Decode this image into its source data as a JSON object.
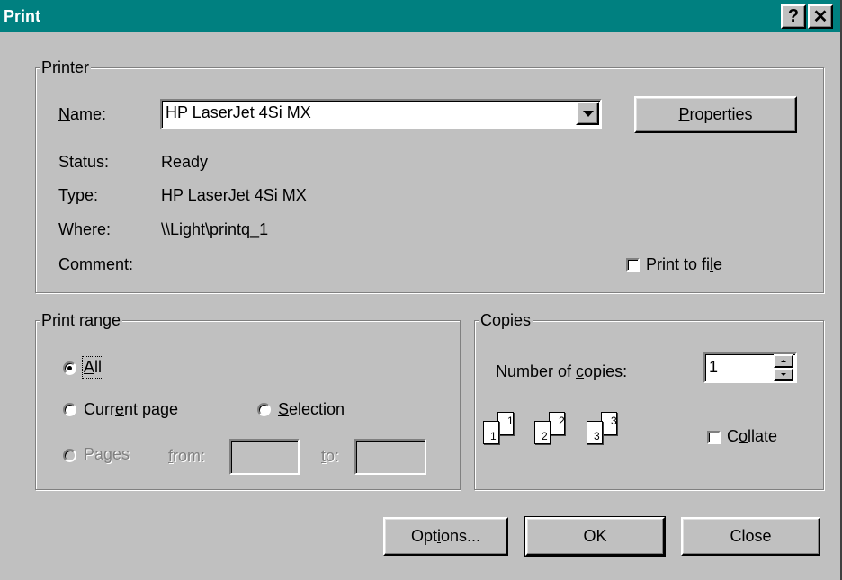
{
  "title": "Print",
  "titlebar": {
    "help": "?",
    "close": "✕"
  },
  "printer": {
    "group_label": "Printer",
    "name_label": "Name:",
    "name_value": "HP LaserJet 4Si MX",
    "properties_button": "Properties",
    "status_label": "Status:",
    "status_value": "Ready",
    "type_label": "Type:",
    "type_value": "HP LaserJet 4Si MX",
    "where_label": "Where:",
    "where_value": "\\\\Light\\printq_1",
    "comment_label": "Comment:",
    "comment_value": "",
    "print_to_file_label": "Print to file",
    "print_to_file_checked": false
  },
  "print_range": {
    "group_label": "Print range",
    "all_label": "All",
    "current_page_label": "Current page",
    "selection_label": "Selection",
    "pages_label": "Pages",
    "from_label": "from:",
    "to_label": "to:",
    "from_value": "",
    "to_value": "",
    "selected": "All"
  },
  "copies": {
    "group_label": "Copies",
    "number_label": "Number of copies:",
    "number_value": "1",
    "collate_label": "Collate",
    "collate_checked": false,
    "page_icons": [
      "1",
      "1",
      "2",
      "2",
      "3",
      "3"
    ]
  },
  "buttons": {
    "options": "Options...",
    "ok": "OK",
    "close": "Close"
  },
  "colors": {
    "titlebar": "#008080",
    "face": "#c0c0c0"
  }
}
